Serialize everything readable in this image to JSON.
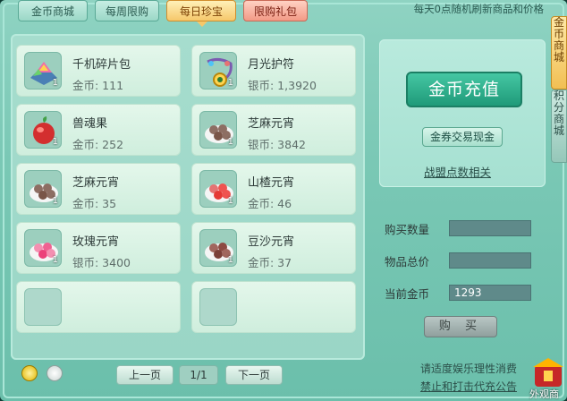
{
  "tabs": [
    {
      "label": "金币商城",
      "active": false
    },
    {
      "label": "每周限购",
      "active": false
    },
    {
      "label": "每日珍宝",
      "active": true
    },
    {
      "label": "限购礼包",
      "active": false
    }
  ],
  "notice": "每天0点随机刷新商品和价格",
  "items": [
    {
      "name": "千机碎片包",
      "price": "金币: 111",
      "count": "1",
      "icon": "shards-pack-icon"
    },
    {
      "name": "月光护符",
      "price": "银币: 1,3920",
      "count": "1",
      "icon": "moonlight-amulet-icon"
    },
    {
      "name": "兽魂果",
      "price": "金币: 252",
      "count": "1",
      "icon": "beast-soul-fruit-icon"
    },
    {
      "name": "芝麻元宵",
      "price": "银币: 3842",
      "count": "1",
      "icon": "sesame-dumpling-icon"
    },
    {
      "name": "芝麻元宵",
      "price": "金币: 35",
      "count": "1",
      "icon": "sesame-dumpling-icon"
    },
    {
      "name": "山楂元宵",
      "price": "金币: 46",
      "count": "1",
      "icon": "hawthorn-dumpling-icon"
    },
    {
      "name": "玫瑰元宵",
      "price": "银币: 3400",
      "count": "1",
      "icon": "rose-dumpling-icon"
    },
    {
      "name": "豆沙元宵",
      "price": "金币: 37",
      "count": "1",
      "icon": "bean-paste-dumpling-icon"
    }
  ],
  "right": {
    "recharge_label": "金币充值",
    "exchange_label": "金券交易现金",
    "alliance_link": "战盟点数相关",
    "qty_label": "购买数量",
    "qty_value": "",
    "total_label": "物品总价",
    "total_value": "",
    "gold_label": "当前金币",
    "gold_value": "1293",
    "buy_label": "购 买"
  },
  "pager": {
    "prev": "上一页",
    "indicator": "1/1",
    "next": "下一页"
  },
  "footer": {
    "line1": "请适度娱乐理性消费",
    "line2": "禁止和打击代充公告"
  },
  "side_tabs": [
    "金币商城",
    "积分商城"
  ],
  "corner_label": "外观商",
  "colors": {
    "active_tab": "#f6c86b",
    "recharge": "#1f9a79",
    "panel": "#7ac8b5"
  }
}
